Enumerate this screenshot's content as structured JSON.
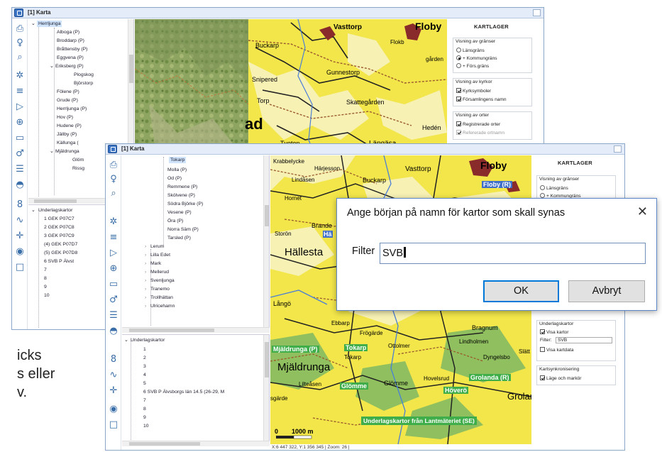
{
  "colors": {
    "map_yellow": "#f2e64a",
    "map_green": "#8fbf5e",
    "road_dark": "#222222",
    "road_brown": "#9b5a2c",
    "water_blue": "#4a7fd6",
    "accent": "#0078d7"
  },
  "back_window": {
    "title": "[1] Karta",
    "tree_items": [
      "Herrljunga",
      "Alboga (P)",
      "Broddarp (P)",
      "Bråttensby (P)",
      "Eggvena (P)",
      "Eriksberg (P)",
      "Plogskog",
      "Björstorp",
      "Fölene (P)",
      "Grude (P)",
      "Herrljunga (P)",
      "Hov (P)",
      "Hudene (P)",
      "Jällby (P)",
      "Källunga (",
      "Mjäldrunga",
      "Glöm",
      "Rissg"
    ],
    "underlag_header": "Underlagskartor",
    "underlag_items": [
      "1   GEK P07C7",
      "2   GEK P07C8",
      "3   GEK P07C9",
      "(4) GEK P07D7",
      "(5) GEK P07D8",
      "6   SVB P Älvst",
      "7",
      "8",
      "9",
      "10"
    ],
    "panel": {
      "title": "KARTLAGER",
      "group1_caption": "Visning av gränser",
      "group1_options": [
        "Länsgräns",
        "+ Kommungräns",
        "+ Förs.gräns"
      ],
      "group2_caption": "Visning av kyrkor",
      "group2_options": [
        "Kyrksymboler",
        "Församlingens namn"
      ],
      "group3_caption": "Visning av orter",
      "group3_options": [
        "Registrerade orter",
        "Refererade ortnamn"
      ]
    },
    "map_labels": [
      "Vasttorp",
      "Floby",
      "Buckarp",
      "Gunnestorp",
      "Snipered",
      "Skattegården",
      "Hedén",
      "Längäsa",
      "Tveten",
      "Torp",
      "ad",
      "Flokb",
      "gården"
    ]
  },
  "front_window": {
    "title": "[1] Karta",
    "tree_items": [
      "Tokarp",
      "Molla (P)",
      "Od (P)",
      "Remmene (P)",
      "Skölvene (P)",
      "Södra Björke (P)",
      "Vesene (P)",
      "Öra (P)",
      "Norra Säm (P)",
      "Tarsled (P)",
      "Lerum",
      "Lilla Edet",
      "Mark",
      "Mellerud",
      "Svenljunga",
      "Tranemo",
      "Trollhättan",
      "Ulricehamn"
    ],
    "underlag_header": "Underlagskartor",
    "underlag_items": [
      "1",
      "2",
      "3",
      "4",
      "5",
      "6   SVB P Älvsborgs län 14.5 (26-29, M",
      "7",
      "8",
      "9",
      "10"
    ],
    "panel": {
      "title": "KARTLAGER",
      "group1_caption": "Visning av gränser",
      "group1_options": [
        "Länsgräns",
        "+ Kommungräns"
      ],
      "underlag_caption": "Underlagskartor",
      "visa_kartor": "Visa kartor",
      "filter_label": "Filter:",
      "filter_value": "SVB",
      "visa_kartdata": "Visa kartdata",
      "synk_caption": "Kartsynkronisering",
      "lage_markor": "Läge och markör"
    },
    "map_labels": [
      "Krabbelycke",
      "Härjesson",
      "Vasttorp",
      "Floby",
      "Floby (R)",
      "Buckarp",
      "Lindåsen",
      "Hornet",
      "Storön",
      "Hä",
      "Brande",
      "Hällesta",
      "Långö",
      "Ebbarp",
      "Frögärde",
      "Bragnum",
      "Mjäldrunga (P)",
      "Tokarp",
      "Tokarp",
      "Ottolmer",
      "Lindholmen",
      "Mjäldrunga",
      "Hovelsrud",
      "Dyngelsbo",
      "Slätt",
      "Lilteåsen",
      "Glömme",
      "Glömme",
      "Höverö",
      "Grolanda (R)",
      "Grolar",
      "sgärde",
      "Underlagskartor från  Lantmäteriet (SE)",
      "0",
      "1000 m"
    ],
    "status": "X:6 447 322, Y:1 356 345  |  Zoom: 26  |"
  },
  "dialog": {
    "title": "Ange början på namn för kartor som skall synas",
    "close": "✕",
    "filter_label": "Filter",
    "filter_value": "SVB",
    "ok": "OK",
    "cancel": "Avbryt"
  },
  "footnote_lines": [
    "icks",
    "s eller",
    "v."
  ]
}
